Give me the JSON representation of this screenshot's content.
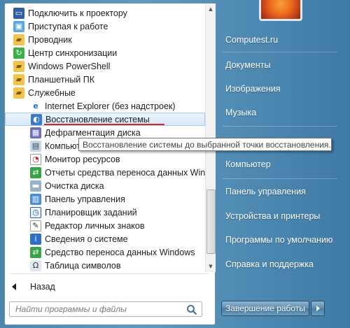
{
  "programs": [
    {
      "label": "Подключить к проектору",
      "icon": "projector-icon",
      "cls": "i-monitor",
      "glyph": "▭",
      "level": 1
    },
    {
      "label": "Приступая к работе",
      "icon": "getting-started-icon",
      "cls": "i-app",
      "glyph": "▣",
      "level": 1
    },
    {
      "label": "Проводник",
      "icon": "explorer-folder-icon",
      "cls": "i-folder",
      "glyph": "▰",
      "level": 1
    },
    {
      "label": "Центр синхронизации",
      "icon": "sync-center-icon",
      "cls": "i-sync",
      "glyph": "↻",
      "level": 1
    },
    {
      "label": "Windows PowerShell",
      "icon": "folder-icon",
      "cls": "i-folder",
      "glyph": "▰",
      "level": 1
    },
    {
      "label": "Планшетный ПК",
      "icon": "folder-icon",
      "cls": "i-folder",
      "glyph": "▰",
      "level": 1
    },
    {
      "label": "Служебные",
      "icon": "folder-icon",
      "cls": "i-folder",
      "glyph": "▰",
      "level": 1
    },
    {
      "label": "Internet Explorer (без надстроек)",
      "icon": "internet-explorer-icon",
      "cls": "i-ie",
      "glyph": "e",
      "level": 2
    },
    {
      "label": "Восстановление системы",
      "icon": "system-restore-icon",
      "cls": "i-restore",
      "glyph": "◐",
      "level": 2,
      "selected": true
    },
    {
      "label": "Дефрагментация диска",
      "icon": "defrag-icon",
      "cls": "i-defrag",
      "glyph": "▦",
      "level": 2
    },
    {
      "label": "Компьютер",
      "icon": "computer-icon",
      "cls": "i-comp",
      "glyph": "▤",
      "level": 2
    },
    {
      "label": "Монитор ресурсов",
      "icon": "resource-monitor-icon",
      "cls": "i-gauge",
      "glyph": "◔",
      "level": 2
    },
    {
      "label": "Отчеты средства переноса данных Windo",
      "icon": "transfer-reports-icon",
      "cls": "i-transfer",
      "glyph": "⇄",
      "level": 2
    },
    {
      "label": "Очистка диска",
      "icon": "disk-cleanup-icon",
      "cls": "i-disk",
      "glyph": "▬",
      "level": 2
    },
    {
      "label": "Панель управления",
      "icon": "control-panel-icon",
      "cls": "i-cp",
      "glyph": "▥",
      "level": 2
    },
    {
      "label": "Планировщик заданий",
      "icon": "task-scheduler-icon",
      "cls": "i-clock",
      "glyph": "◷",
      "level": 2
    },
    {
      "label": "Редактор личных знаков",
      "icon": "char-editor-icon",
      "cls": "i-edit",
      "glyph": "✎",
      "level": 2
    },
    {
      "label": "Сведения о системе",
      "icon": "system-info-icon",
      "cls": "i-info",
      "glyph": "i",
      "level": 2
    },
    {
      "label": "Средство переноса данных Windows",
      "icon": "easy-transfer-icon",
      "cls": "i-transfer",
      "glyph": "⇄",
      "level": 2
    },
    {
      "label": "Таблица символов",
      "icon": "char-map-icon",
      "cls": "i-map",
      "glyph": "Ω",
      "level": 2
    }
  ],
  "tooltip": "Восстановление системы до выбранной точки восстановления.",
  "back_label": "Назад",
  "search": {
    "placeholder": "Найти программы и файлы"
  },
  "right_pane": {
    "items": [
      {
        "label": "Computest.ru",
        "name": "right-item-user"
      },
      {
        "label": "Документы",
        "name": "right-item-documents"
      },
      {
        "label": "Изображения",
        "name": "right-item-pictures"
      },
      {
        "label": "Музыка",
        "name": "right-item-music"
      },
      {
        "label": "Компьютер",
        "name": "right-item-computer"
      },
      {
        "label": "Панель управления",
        "name": "right-item-control-panel"
      },
      {
        "label": "Устройства и принтеры",
        "name": "right-item-devices"
      },
      {
        "label": "Программы по умолчанию",
        "name": "right-item-default-programs"
      },
      {
        "label": "Справка и поддержка",
        "name": "right-item-help"
      }
    ]
  },
  "shutdown_label": "Завершение работы",
  "colors": {
    "highlight_underline": "#e0202a",
    "accent": "#3f7aa6"
  }
}
